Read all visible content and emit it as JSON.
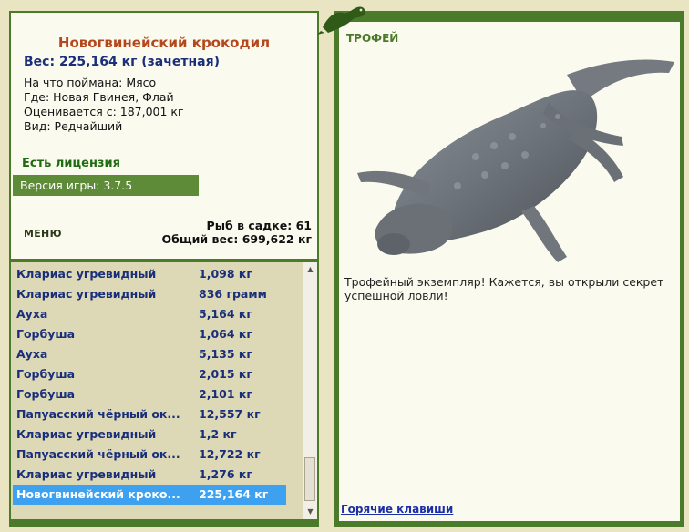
{
  "fish": {
    "name": "Новогвинейский крокодил",
    "weight_line": "Вес: 225,164 кг (зачетная)",
    "bait": "На что поймана: Мясо",
    "location": "Где: Новая Гвинея, Флай",
    "valued_from": "Оценивается с: 187,001 кг",
    "rarity": "Вид: Редчайший"
  },
  "license": "Есть лицензия",
  "version": "Версия игры: 3.7.5",
  "menu_label": "МЕНЮ",
  "stats": {
    "fish_in_keepnet": "Рыб в садке: 61",
    "total_weight": "Общий вес: 699,622 кг"
  },
  "catch_list": [
    {
      "name": "Клариас угревидный",
      "weight": "1,098 кг"
    },
    {
      "name": "Клариас угревидный",
      "weight": "836 грамм"
    },
    {
      "name": "Ауха",
      "weight": "5,164 кг"
    },
    {
      "name": "Горбуша",
      "weight": "1,064 кг"
    },
    {
      "name": "Ауха",
      "weight": "5,135 кг"
    },
    {
      "name": "Горбуша",
      "weight": "2,015 кг"
    },
    {
      "name": "Горбуша",
      "weight": "2,101 кг"
    },
    {
      "name": "Папуасский чёрный ок...",
      "weight": "12,557 кг"
    },
    {
      "name": "Клариас угревидный",
      "weight": "1,2 кг"
    },
    {
      "name": "Папуасский чёрный ок...",
      "weight": "12,722 кг"
    },
    {
      "name": "Клариас угревидный",
      "weight": "1,276 кг"
    },
    {
      "name": "Новогвинейский кроко...",
      "weight": "225,164 кг"
    }
  ],
  "selected_index": 11,
  "trophy": {
    "title": "ТРОФЕЙ",
    "text": "Трофейный экземпляр! Кажется, вы открыли секрет успешной ловли!"
  },
  "hotkeys_link": "Горячие клавиши",
  "icons": {
    "scroll_up": "scroll-up-arrow-icon",
    "scroll_down": "scroll-down-arrow-icon",
    "lizard": "lizard-icon",
    "crocodile": "crocodile-icon"
  },
  "colors": {
    "frame_green": "#4b7a2b",
    "panel_bg": "#fbfaef",
    "list_bg": "#ddd8b6",
    "fish_name": "#b4471b",
    "text_blue": "#1a2f7a",
    "selection": "#3ea1ef",
    "license_green": "#1f6b12"
  }
}
